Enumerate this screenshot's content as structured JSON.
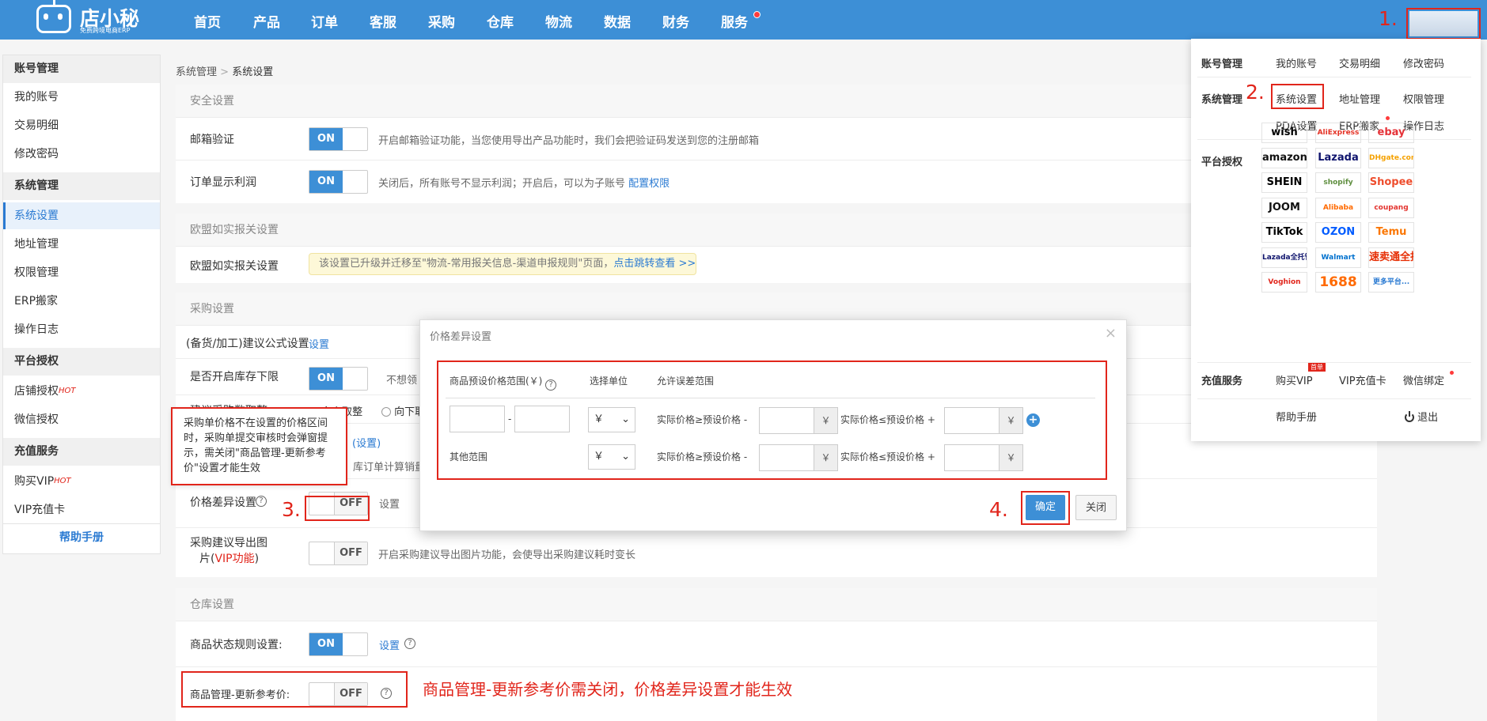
{
  "app": {
    "logo_name": "店小秘",
    "logo_sub": "免费跨境电商ERP"
  },
  "nav": [
    "首页",
    "产品",
    "订单",
    "客服",
    "采购",
    "仓库",
    "物流",
    "数据",
    "财务",
    "服务"
  ],
  "steps": {
    "s1": "1.",
    "s2": "2.",
    "s3": "3.",
    "s4": "4."
  },
  "sidebar": {
    "account_head": "账号管理",
    "my_account": "我的账号",
    "transactions": "交易明细",
    "change_password": "修改密码",
    "system_head": "系统管理",
    "system_settings": "系统设置",
    "address": "地址管理",
    "permission": "权限管理",
    "erp_move": "ERP搬家",
    "op_log": "操作日志",
    "platform_head": "平台授权",
    "shop_auth": "店铺授权",
    "hot": "HOT",
    "wechat_auth": "微信授权",
    "recharge_head": "充值服务",
    "buy_vip": "购买VIP",
    "vip_card": "VIP充值卡",
    "help": "帮助手册"
  },
  "breadcrumb": {
    "parent": "系统管理",
    "sep": ">",
    "current": "系统设置"
  },
  "security": {
    "title": "安全设置",
    "email_label": "邮箱验证",
    "email_toggle": "ON",
    "email_desc": "开启邮箱验证功能，当您使用导出产品功能时，我们会把验证码发送到您的注册邮箱",
    "profit_label": "订单显示利润",
    "profit_toggle": "ON",
    "profit_desc": "关闭后，所有账号不显示利润；开启后，可以为子账号",
    "profit_link": "配置权限"
  },
  "eu": {
    "title": "欧盟如实报关设置",
    "label": "欧盟如实报关设置",
    "notice": "该设置已升级并迁移至\"物流-常用报关信息-渠道申报规则\"页面，",
    "notice_link": "点击跳转查看 >>"
  },
  "purchase": {
    "title": "采购设置",
    "formula_label": "(备货/加工)建议公式设置",
    "formula_link": "设置",
    "stock_label": "是否开启库存下限",
    "stock_toggle": "ON",
    "stock_desc": "不想领",
    "round_label": "建议采购数取整",
    "round_up": "向上取整",
    "round_down": "向下取",
    "settings_link_paren": "(设置)",
    "calc_desc": "库订单计算销量",
    "diff_label": "价格差异设置",
    "diff_toggle": "OFF",
    "diff_link": "设置",
    "export_label_1": "采购建议导出图",
    "export_label_2a": "片(",
    "export_label_vip": "VIP功能",
    "export_label_2b": ")",
    "export_toggle": "OFF",
    "export_desc": "开启采购建议导出图片功能，会使导出采购建议耗时变长"
  },
  "tooltip": "采购单价格不在设置的价格区间时，采购单提交审核时会弹窗提示，需关闭\"商品管理-更新参考价\"设置才能生效",
  "warehouse": {
    "title": "仓库设置",
    "status_label": "商品状态规则设置:",
    "status_toggle": "ON",
    "status_link": "设置",
    "ref_label": "商品管理-更新参考价:",
    "ref_toggle": "OFF",
    "note": "商品管理-更新参考价需关闭，价格差异设置才能生效"
  },
  "modal": {
    "title": "价格差异设置",
    "close": "×",
    "col_range": "商品预设价格范围(￥)",
    "col_unit": "选择单位",
    "col_tolerance": "允许误差范围",
    "dash": "-",
    "unit_value": "￥",
    "cond_ge": "实际价格≥预设价格 -",
    "cond_le": "实际价格≤预设价格 +",
    "yen": "￥",
    "plus": "+",
    "other_range": "其他范围",
    "confirm": "确定",
    "close_btn": "关闭"
  },
  "dropdown": {
    "account_head": "账号管理",
    "my_account": "我的账号",
    "transactions": "交易明细",
    "change_password": "修改密码",
    "system_head": "系统管理",
    "system_settings": "系统设置",
    "address": "地址管理",
    "permission": "权限管理",
    "pda": "PDA设置",
    "erp_move": "ERP搬家",
    "op_log": "操作日志",
    "platform_head": "平台授权",
    "platforms": [
      "wish",
      "AliExpress",
      "ebay",
      "amazon",
      "Lazada",
      "DHgate.com",
      "SHEIN",
      "shopify",
      "Shopee",
      "JOOM",
      "Alibaba",
      "coupang",
      "TikTok",
      "OZON",
      "Temu",
      "Lazada全托管",
      "Walmart",
      "速卖通全托管",
      "Voghion",
      "1688",
      "更多平台..."
    ],
    "recharge_head": "充值服务",
    "buy_vip": "购买VIP",
    "vip_badge": "首单",
    "vip_card": "VIP充值卡",
    "wechat": "微信绑定",
    "help": "帮助手册",
    "logout": "退出"
  },
  "colors": {
    "brand_blue": "#3d8fd6",
    "annotation_red": "#e1251b",
    "link_blue": "#2a7ad2"
  }
}
